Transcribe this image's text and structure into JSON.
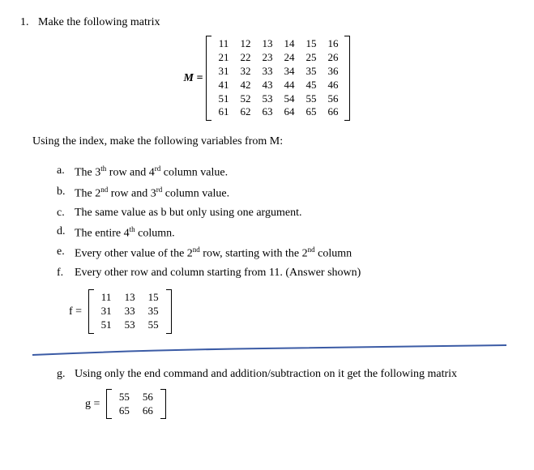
{
  "question": {
    "number": "1.",
    "text": "Make the following matrix",
    "intro": "Using the index, make the following variables from M:"
  },
  "matrix_M": {
    "label": "M =",
    "rows": [
      [
        "11",
        "12",
        "13",
        "14",
        "15",
        "16"
      ],
      [
        "21",
        "22",
        "23",
        "24",
        "25",
        "26"
      ],
      [
        "31",
        "32",
        "33",
        "34",
        "35",
        "36"
      ],
      [
        "41",
        "42",
        "43",
        "44",
        "45",
        "46"
      ],
      [
        "51",
        "52",
        "53",
        "54",
        "55",
        "56"
      ],
      [
        "61",
        "62",
        "63",
        "64",
        "65",
        "66"
      ]
    ]
  },
  "sub_items": {
    "a": {
      "letter": "a.",
      "text_parts": [
        "The 3",
        "th",
        " row and 4",
        "rd",
        " column value."
      ]
    },
    "b": {
      "letter": "b.",
      "text_parts": [
        "The 2",
        "nd",
        " row and 3",
        "rd",
        " column value."
      ]
    },
    "c": {
      "letter": "c.",
      "text": "The same value as b but only using one argument."
    },
    "d": {
      "letter": "d.",
      "text_parts": [
        "The entire 4",
        "th",
        " column."
      ]
    },
    "e": {
      "letter": "e.",
      "text_parts": [
        "Every other value of the 2",
        "nd",
        " row, starting with the 2",
        "nd",
        " column"
      ]
    },
    "f": {
      "letter": "f.",
      "text": "Every other row and column starting from 11. (Answer shown)"
    },
    "g": {
      "letter": "g.",
      "text": "Using only the end command and addition/subtraction on it get the following matrix"
    }
  },
  "matrix_f": {
    "label": "f =",
    "rows": [
      [
        "11",
        "13",
        "15"
      ],
      [
        "31",
        "33",
        "35"
      ],
      [
        "51",
        "53",
        "55"
      ]
    ]
  },
  "matrix_g": {
    "label": "g =",
    "rows": [
      [
        "55",
        "56"
      ],
      [
        "65",
        "66"
      ]
    ]
  }
}
